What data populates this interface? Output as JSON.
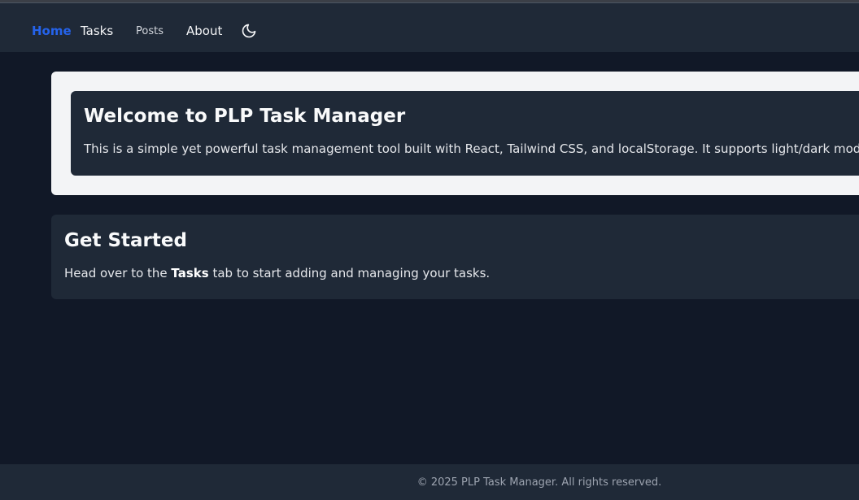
{
  "nav": {
    "home": "Home",
    "tasks": "Tasks",
    "posts": "Posts",
    "about": "About",
    "theme_icon": "moon-icon"
  },
  "welcome": {
    "title": "Welcome to PLP Task Manager",
    "text": "This is a simple yet powerful task management tool built with React, Tailwind CSS, and localStorage. It supports light/dark mode, filtering"
  },
  "get_started": {
    "title": "Get Started",
    "text_before": "Head over to the ",
    "text_bold": "Tasks",
    "text_after": " tab to start adding and managing your tasks."
  },
  "footer": {
    "text": "© 2025 PLP Task Manager. All rights reserved."
  },
  "colors": {
    "accent": "#2563eb",
    "background": "#111827",
    "surface": "#1f2937",
    "light_surface": "#f3f4f6"
  }
}
